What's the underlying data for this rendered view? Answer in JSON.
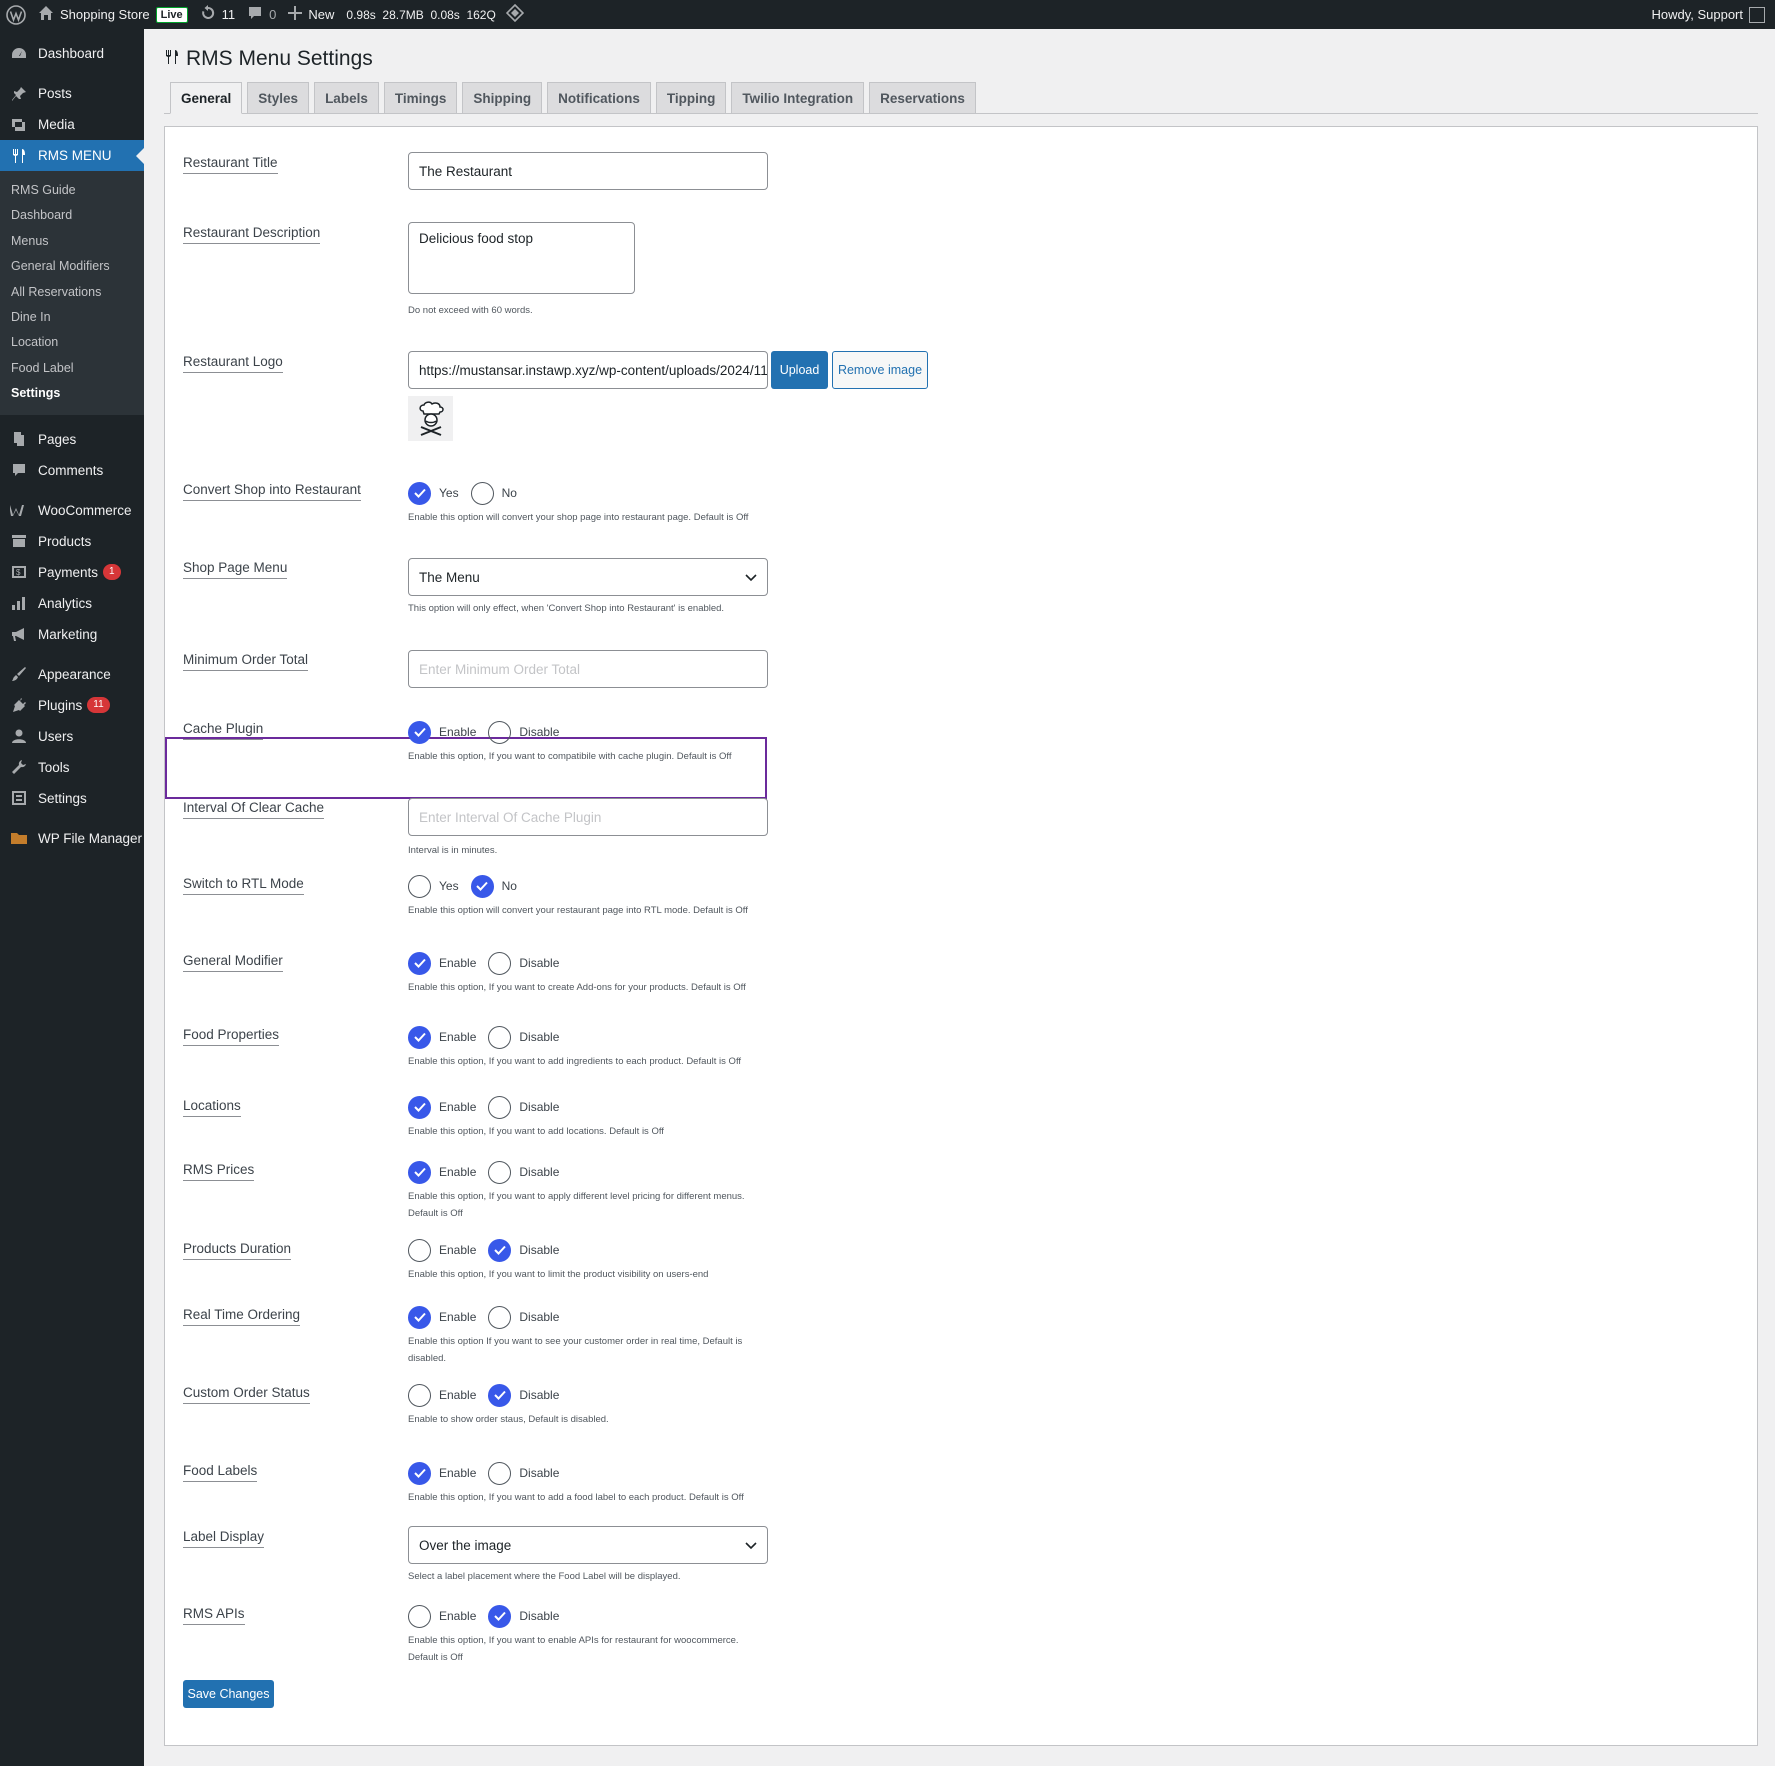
{
  "adminbar": {
    "site_name": "Shopping Store",
    "live_badge": "Live",
    "updates_count": "11",
    "comments_count": "0",
    "new_label": "New",
    "stats": "0.98s  28.7MB  0.08s  162Q",
    "greeting": "Howdy, Support"
  },
  "sidebar": {
    "dashboard": "Dashboard",
    "posts": "Posts",
    "media": "Media",
    "rms_menu": "RMS MENU",
    "submenu": [
      "RMS Guide",
      "Dashboard",
      "Menus",
      "General Modifiers",
      "All Reservations",
      "Dine In",
      "Location",
      "Food Label",
      "Settings"
    ],
    "pages": "Pages",
    "comments": "Comments",
    "woocommerce": "WooCommerce",
    "products": "Products",
    "payments": "Payments",
    "payments_badge": "1",
    "analytics": "Analytics",
    "marketing": "Marketing",
    "appearance": "Appearance",
    "plugins": "Plugins",
    "plugins_badge": "11",
    "users": "Users",
    "tools": "Tools",
    "settings": "Settings",
    "wp_file_manager": "WP File Manager"
  },
  "page": {
    "title": "RMS Menu Settings",
    "tabs": [
      "General",
      "Styles",
      "Labels",
      "Timings",
      "Shipping",
      "Notifications",
      "Tipping",
      "Twilio Integration",
      "Reservations"
    ],
    "active_tab": "General"
  },
  "form": {
    "restaurant_title": {
      "label": "Restaurant Title",
      "value": "The Restaurant"
    },
    "restaurant_description": {
      "label": "Restaurant Description",
      "value": "Delicious food stop",
      "desc": "Do not exceed with 60 words."
    },
    "restaurant_logo": {
      "label": "Restaurant Logo",
      "value": "https://mustansar.instawp.xyz/wp-content/uploads/2024/11/C",
      "upload_label": "Upload",
      "remove_label": "Remove image"
    },
    "convert_shop": {
      "label": "Convert Shop into Restaurant",
      "opt1": "Yes",
      "opt2": "No",
      "selected": "Yes",
      "desc": "Enable this option will convert your shop page into restaurant page. Default is Off"
    },
    "shop_page_menu": {
      "label": "Shop Page Menu",
      "value": "The Menu",
      "desc": "This option will only effect, when 'Convert Shop into Restaurant' is enabled."
    },
    "minimum_order_total": {
      "label": "Minimum Order Total",
      "placeholder": "Enter Minimum Order Total"
    },
    "cache_plugin": {
      "label": "Cache Plugin",
      "opt1": "Enable",
      "opt2": "Disable",
      "selected": "Enable",
      "desc": "Enable this option, If you want to compatibile with cache plugin. Default is Off"
    },
    "interval_clear_cache": {
      "label": "Interval Of Clear Cache",
      "placeholder": "Enter Interval Of Cache Plugin",
      "desc": "Interval is in minutes."
    },
    "rtl_mode": {
      "label": "Switch to RTL Mode",
      "opt1": "Yes",
      "opt2": "No",
      "selected": "No",
      "desc": "Enable this option will convert your restaurant page into RTL mode. Default is Off"
    },
    "general_modifier": {
      "label": "General Modifier",
      "opt1": "Enable",
      "opt2": "Disable",
      "selected": "Enable",
      "desc": "Enable this option, If you want to create Add-ons for your products. Default is Off"
    },
    "food_properties": {
      "label": "Food Properties",
      "opt1": "Enable",
      "opt2": "Disable",
      "selected": "Enable",
      "desc": "Enable this option, If you want to add ingredients to each product. Default is Off"
    },
    "locations": {
      "label": "Locations",
      "opt1": "Enable",
      "opt2": "Disable",
      "selected": "Enable",
      "desc": "Enable this option, If you want to add locations. Default is Off"
    },
    "rms_prices": {
      "label": "RMS Prices",
      "opt1": "Enable",
      "opt2": "Disable",
      "selected": "Enable",
      "desc1": "Enable this option, If you want to apply different level pricing for different menus.",
      "desc2": "Default is Off"
    },
    "products_duration": {
      "label": "Products Duration",
      "opt1": "Enable",
      "opt2": "Disable",
      "selected": "Disable",
      "desc": "Enable this option, If you want to limit the product visibility on users-end"
    },
    "real_time_ordering": {
      "label": "Real Time Ordering",
      "opt1": "Enable",
      "opt2": "Disable",
      "selected": "Enable",
      "desc1": "Enable this option If you want to see your customer order in real time, Default is",
      "desc2": "disabled."
    },
    "custom_order_status": {
      "label": "Custom Order Status",
      "opt1": "Enable",
      "opt2": "Disable",
      "selected": "Disable",
      "desc": "Enable to show order staus, Default is disabled."
    },
    "food_labels": {
      "label": "Food Labels",
      "opt1": "Enable",
      "opt2": "Disable",
      "selected": "Enable",
      "desc": "Enable this option, If you want to add a food label to each product. Default is Off"
    },
    "label_display": {
      "label": "Label Display",
      "value": "Over the image",
      "desc": "Select a label placement where the Food Label will be displayed."
    },
    "rms_apis": {
      "label": "RMS APIs",
      "opt1": "Enable",
      "opt2": "Disable",
      "selected": "Disable",
      "desc1": "Enable this option, If you want to enable APIs for restaurant for woocommerce.",
      "desc2": "Default is Off"
    },
    "save_label": "Save Changes"
  },
  "colors": {
    "accent": "#2271b1",
    "radio_on": "#3858e9",
    "highlight": "#6b2a9c",
    "sidebar_bg": "#1d2327"
  }
}
